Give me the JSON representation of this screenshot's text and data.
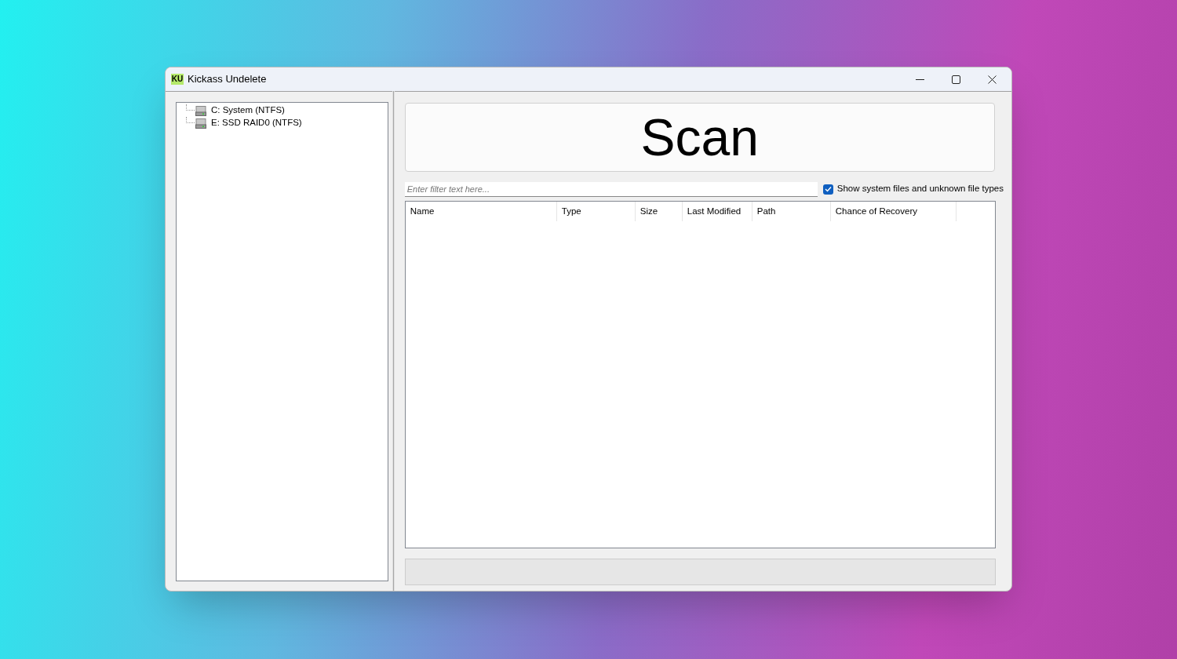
{
  "window": {
    "title": "Kickass Undelete",
    "app_icon": "KU"
  },
  "drive_tree": {
    "items": [
      {
        "label": "C: System (NTFS)"
      },
      {
        "label": "E: SSD RAID0 (NTFS)"
      }
    ]
  },
  "scan_button": {
    "label": "Scan"
  },
  "filter": {
    "placeholder": "Enter filter text here..."
  },
  "show_system_files": {
    "label": "Show system files and unknown file types",
    "checked": true
  },
  "table": {
    "columns": [
      "Name",
      "Type",
      "Size",
      "Last Modified",
      "Path",
      "Chance of Recovery"
    ]
  }
}
